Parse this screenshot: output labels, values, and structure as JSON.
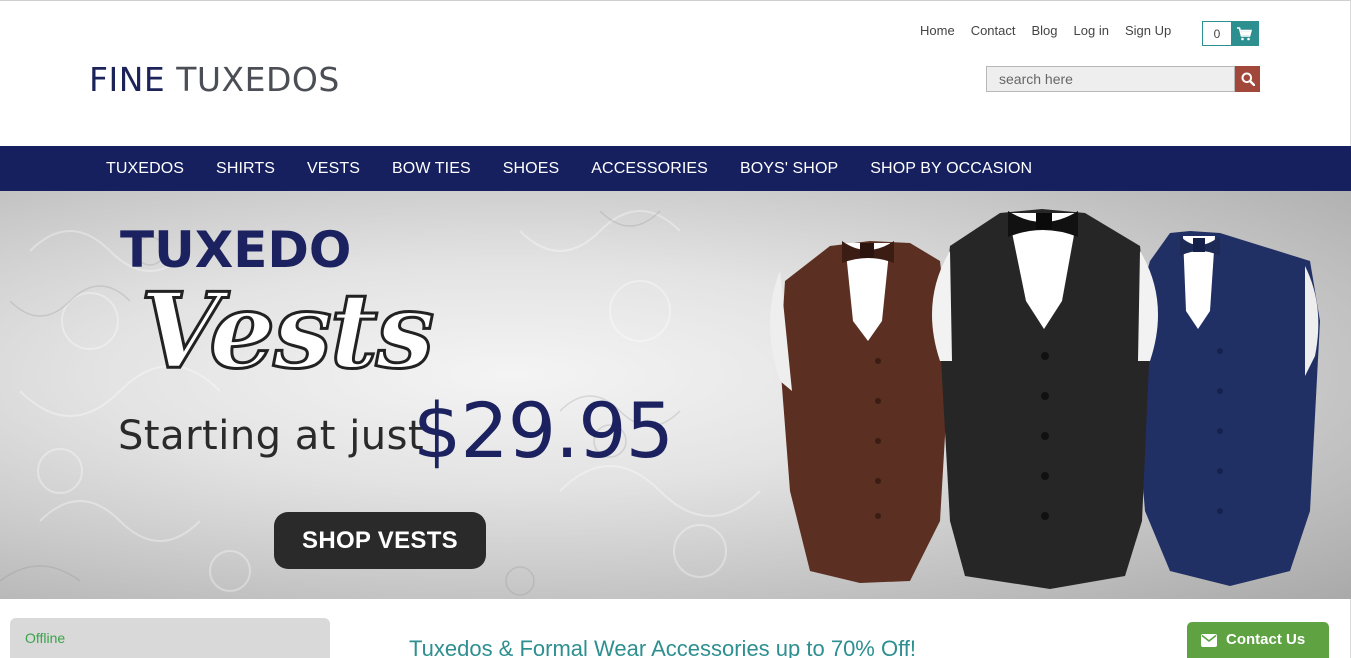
{
  "header": {
    "logo_part1": "FINE ",
    "logo_part2": "TUXEDOS",
    "links": [
      "Home",
      "Contact",
      "Blog",
      "Log in",
      "Sign Up"
    ],
    "cart_count": "0",
    "search_placeholder": "search here"
  },
  "nav": {
    "items": [
      "TUXEDOS",
      "SHIRTS",
      "VESTS",
      "BOW TIES",
      "SHOES",
      "ACCESSORIES",
      "BOYS' SHOP",
      "SHOP BY OCCASION"
    ]
  },
  "hero": {
    "title_line1": "TUXEDO",
    "title_line2": "Vests",
    "subtitle": "Starting at just",
    "price": "$29.95",
    "cta": "SHOP VESTS"
  },
  "footer_bar": {
    "chat_status": "Offline",
    "promo": "Tuxedos & Formal Wear Accessories up to 70% Off!",
    "contact_label": "Contact Us"
  },
  "colors": {
    "navy": "#16205f",
    "teal": "#2e8f90",
    "search_button": "#a1483a",
    "contact_green": "#5ea242"
  }
}
